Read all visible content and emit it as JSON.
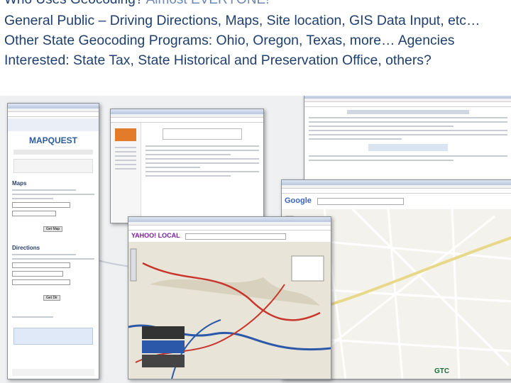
{
  "slide": {
    "title_main": "Who Uses Geocoding?",
    "title_dim": "Almost EVERYONE!",
    "lines": [
      "General Public – Driving Directions, Maps, Site location, GIS Data Input, etc… Other State Geocoding Programs: Ohio, Oregon, Texas, more… Agencies Interested: State Tax, State Historical and Preservation Office, others?"
    ]
  },
  "screenshots": {
    "mapquest": {
      "logo": "MAPQUEST",
      "maps_label": "Maps",
      "directions_label": "Directions"
    },
    "yahoo": {
      "logo": "YAHOO! LOCAL"
    },
    "google": {
      "logo": "Google"
    },
    "wvgis": {
      "logo": "GTC"
    }
  },
  "colors": {
    "title": "#1f3f6e",
    "road": "#c8362b",
    "water": "#2b58a8"
  }
}
